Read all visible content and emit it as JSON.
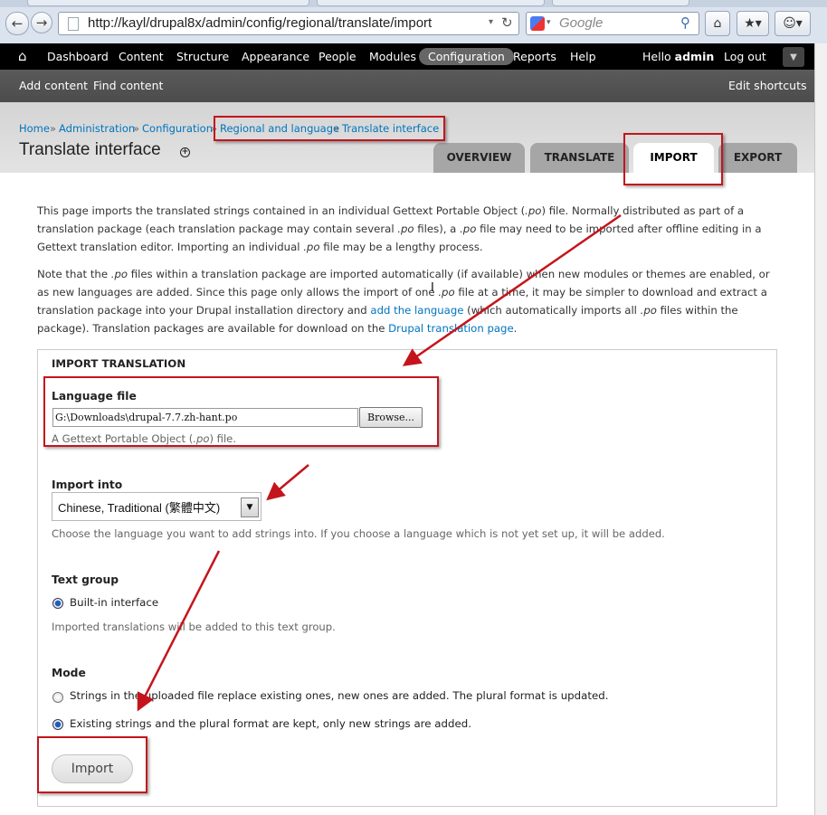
{
  "browser": {
    "url": "http://kayl/drupal8x/admin/config/regional/translate/import",
    "search_placeholder": "Google"
  },
  "toolbar": {
    "items": [
      "Dashboard",
      "Content",
      "Structure",
      "Appearance",
      "People",
      "Modules",
      "Configuration",
      "Reports",
      "Help"
    ],
    "active_item": "Configuration",
    "hello": "Hello",
    "user": "admin",
    "logout": "Log out"
  },
  "shortcuts": {
    "add_content": "Add content",
    "find_content": "Find content",
    "edit_shortcuts": "Edit shortcuts"
  },
  "breadcrumb": [
    "Home",
    "Administration",
    "Configuration",
    "Regional and language",
    "Translate interface"
  ],
  "breadcrumb_sep": "»",
  "page_title": "Translate interface",
  "tabs": [
    {
      "label": "OVERVIEW",
      "active": false
    },
    {
      "label": "TRANSLATE",
      "active": false
    },
    {
      "label": "IMPORT",
      "active": true
    },
    {
      "label": "EXPORT",
      "active": false
    }
  ],
  "intro": {
    "p1_a": "This page imports the translated strings contained in an individual Gettext Portable Object (",
    "p1_b": ".po",
    "p1_c": ") file. Normally distributed as part of a translation package (each translation package may contain several ",
    "p1_d": ".po",
    "p1_e": " files), a ",
    "p1_f": ".po",
    "p1_g": " file may need to be imported after offline editing in a Gettext translation editor. Importing an individual ",
    "p1_h": ".po",
    "p1_i": " file may be a lengthy process.",
    "p2_a": "Note that the ",
    "p2_b": ".po",
    "p2_c": " files within a translation package are imported automatically (if available) when new modules or themes are enabled, or as new languages are added. Since this page only allows the import of one ",
    "p2_d": ".po",
    "p2_e": " file at a time, it may be simpler to download and extract a translation package into your Drupal installation directory and ",
    "p2_link1": "add the language",
    "p2_f": " (which automatically imports all ",
    "p2_g": ".po",
    "p2_h": " files within the package). Translation packages are available for download on the ",
    "p2_link2": "Drupal translation page",
    "p2_i": "."
  },
  "form": {
    "legend": "IMPORT TRANSLATION",
    "language_file_label": "Language file",
    "language_file_value": "G:\\Downloads\\drupal-7.7.zh-hant.po",
    "browse_label": "Browse...",
    "language_file_desc_a": "A Gettext Portable Object (",
    "language_file_desc_b": ".po",
    "language_file_desc_c": ") file.",
    "import_into_label": "Import into",
    "import_into_value": "Chinese, Traditional (繁體中文)",
    "import_into_desc": "Choose the language you want to add strings into. If you choose a language which is not yet set up, it will be added.",
    "text_group_label": "Text group",
    "text_group_option": "Built-in interface",
    "text_group_desc": "Imported translations will be added to this text group.",
    "mode_label": "Mode",
    "mode_option1": "Strings in the uploaded file replace existing ones, new ones are added. The plural format is updated.",
    "mode_option2": "Existing strings and the plural format are kept, only new strings are added.",
    "mode_selected": 2,
    "import_button": "Import"
  },
  "annotation_color": "#c4151c"
}
